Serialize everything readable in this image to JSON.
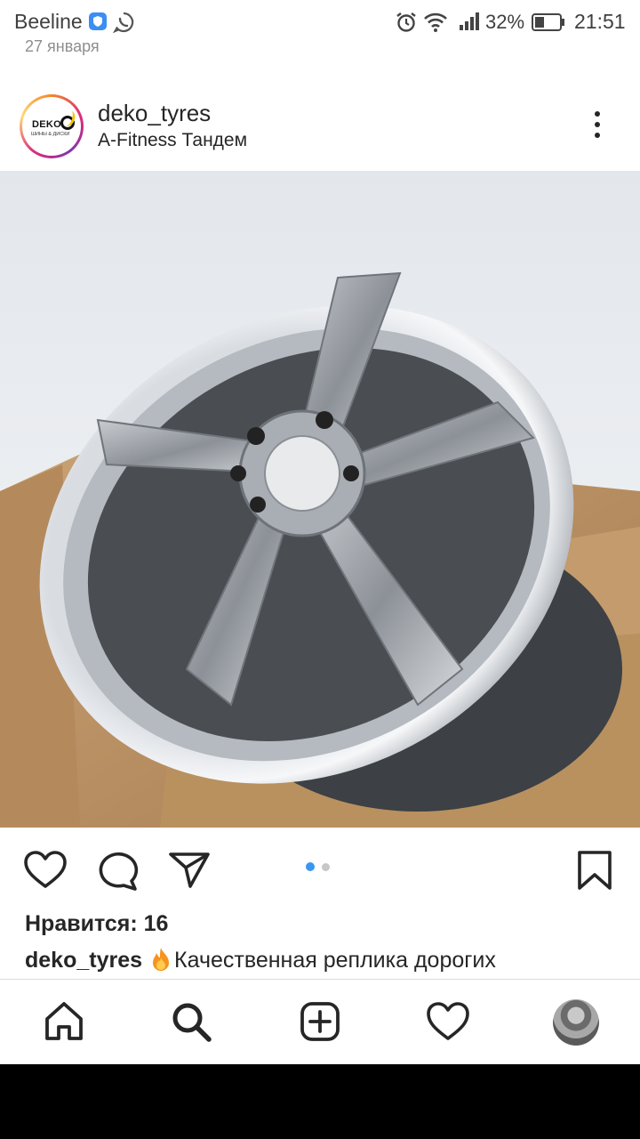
{
  "status_bar": {
    "carrier": "Beeline",
    "battery": "32%",
    "time": "21:51",
    "icons": [
      "shield-icon",
      "whatsapp-icon",
      "alarm-icon",
      "wifi-icon",
      "signal-icon",
      "battery-icon"
    ]
  },
  "post": {
    "date": "27 января",
    "username": "deko_tyres",
    "location": "A-Fitness Тандем",
    "avatar_logo": {
      "text": "DEKO",
      "subtext": "ШИНЫ & ДИСКИ"
    },
    "image_subject": "alloy-wheel-photo",
    "carousel": {
      "total": 2,
      "active": 1
    },
    "likes": "Нравится: 16",
    "caption_user": "deko_tyres",
    "caption_text": "Качественная реплика дорогих"
  },
  "colors": {
    "carousel_active": "#3897f0",
    "carousel_inactive": "#c7c7c7",
    "text": "#262626",
    "muted": "#8e8e8e"
  },
  "bottom_nav": [
    "home-icon",
    "search-icon",
    "new-post-icon",
    "activity-icon",
    "profile-avatar"
  ]
}
